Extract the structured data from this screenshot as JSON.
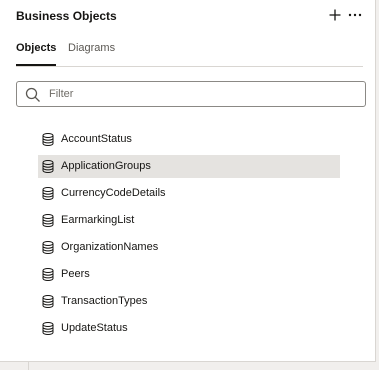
{
  "panel": {
    "title": "Business Objects",
    "add_icon": "plus-icon",
    "more_icon": "ellipsis-icon"
  },
  "tabs": [
    {
      "label": "Objects",
      "active": true
    },
    {
      "label": "Diagrams",
      "active": false
    }
  ],
  "filter": {
    "placeholder": "Filter",
    "value": "",
    "icon": "search-icon"
  },
  "objects": {
    "icon": "database-icon",
    "selected_index": 1,
    "items": [
      {
        "label": "AccountStatus"
      },
      {
        "label": "ApplicationGroups"
      },
      {
        "label": "CurrencyCodeDetails"
      },
      {
        "label": "EarmarkingList"
      },
      {
        "label": "OrganizationNames"
      },
      {
        "label": "Peers"
      },
      {
        "label": "TransactionTypes"
      },
      {
        "label": "UpdateStatus"
      }
    ]
  },
  "colors": {
    "text": "#161513",
    "muted": "#5a5752",
    "selected_bg": "#e5e3e0",
    "border": "#d9d6d2"
  }
}
